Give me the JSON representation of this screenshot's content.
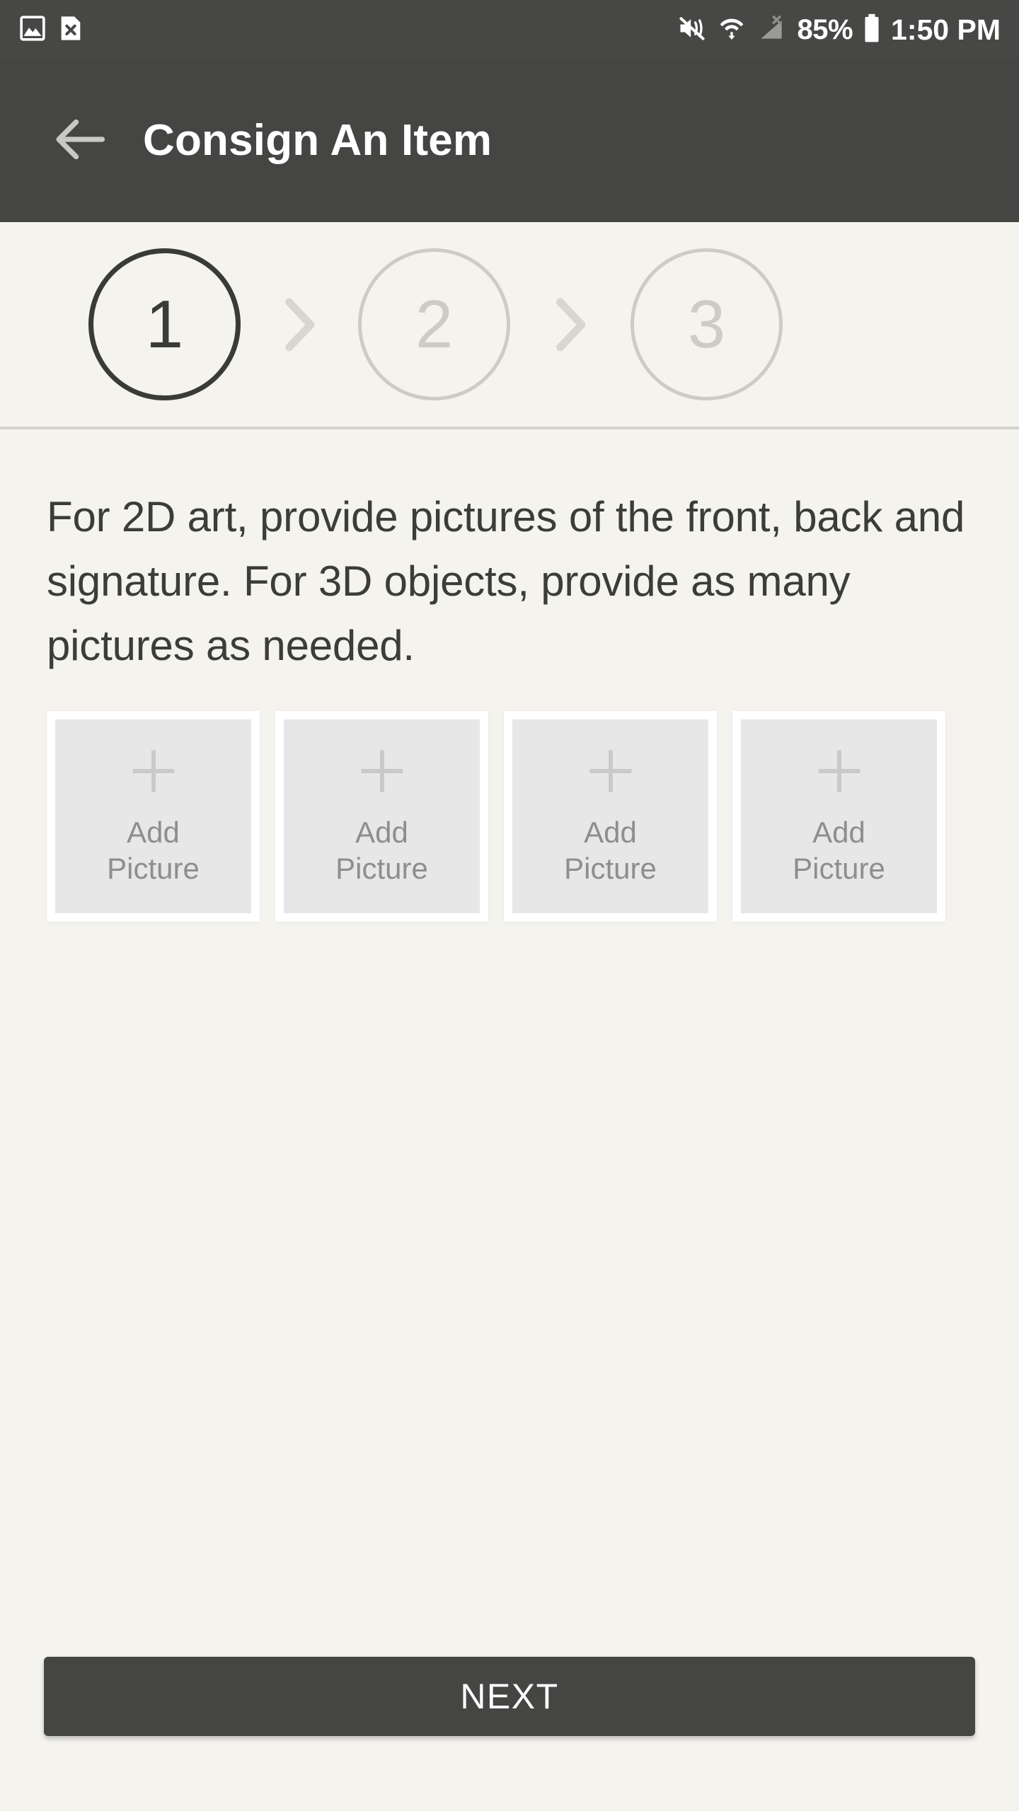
{
  "status_bar": {
    "left_icons": [
      "image-icon",
      "sim-card-x-icon"
    ],
    "right_icons": [
      "mute-vibrate-icon",
      "wifi-icon",
      "cellular-signal-x-icon",
      "battery-icon"
    ],
    "battery_percent": "85%",
    "time": "1:50 PM"
  },
  "app_bar": {
    "back_icon": "arrow-left-icon",
    "title": "Consign An Item"
  },
  "stepper": {
    "separator_icon": "chevron-right-icon",
    "steps": [
      {
        "label": "1",
        "state": "active"
      },
      {
        "label": "2",
        "state": "inactive"
      },
      {
        "label": "3",
        "state": "inactive"
      }
    ]
  },
  "content": {
    "instructions": "For 2D art, provide pictures of the front, back and signature. For 3D objects, provide as many pictures as needed.",
    "tiles": [
      {
        "icon": "plus-icon",
        "label": "Add\nPicture"
      },
      {
        "icon": "plus-icon",
        "label": "Add\nPicture"
      },
      {
        "icon": "plus-icon",
        "label": "Add\nPicture"
      },
      {
        "icon": "plus-icon",
        "label": "Add\nPicture"
      }
    ],
    "tile_label_line1": "Add",
    "tile_label_line2": "Picture"
  },
  "footer": {
    "next_label": "NEXT"
  },
  "colors": {
    "page_background": "#f4f3ee",
    "app_bar": "#454543",
    "status_bar": "#474745",
    "active_step": "#3a3a37",
    "inactive_step": "#cdcbc6",
    "divider": "#d4d2cc",
    "tile_frame": "#ffffff",
    "tile_inner": "#e7e7e7",
    "tile_text": "#8e8e8e",
    "primary_button": "#454543",
    "text_primary": "#3c3c39"
  }
}
